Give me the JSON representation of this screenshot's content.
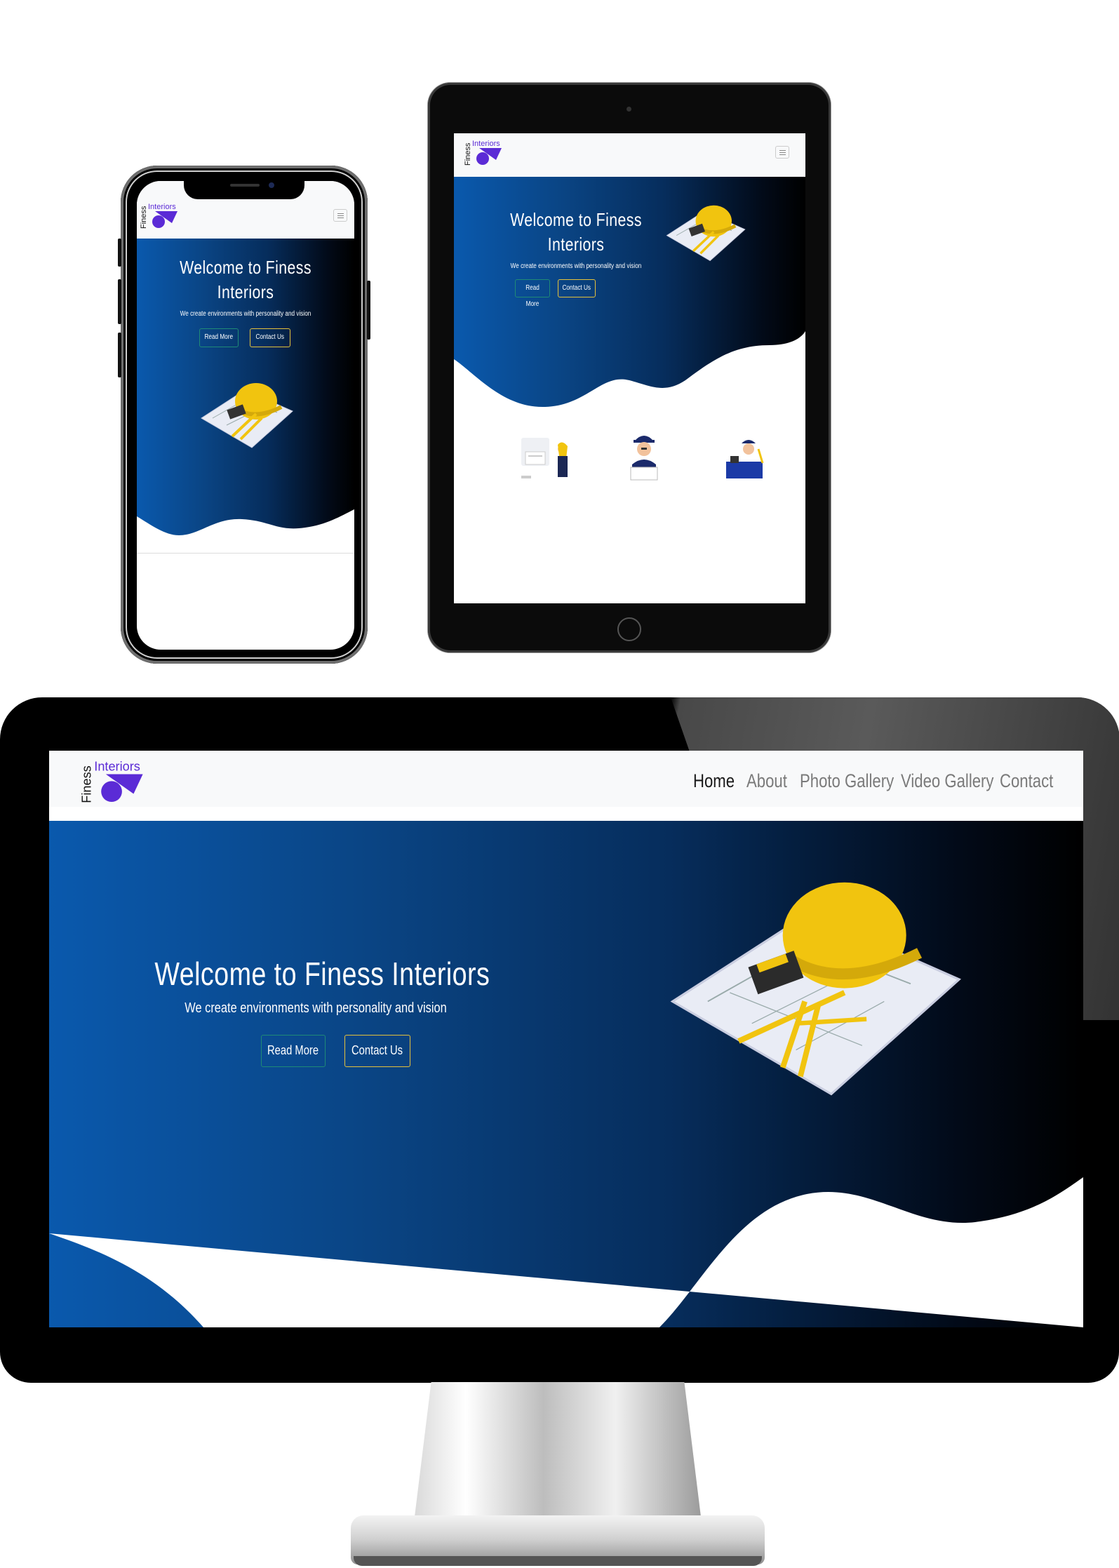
{
  "site": {
    "logo": {
      "word1": "Finess",
      "word2": "Interiors"
    },
    "hero": {
      "title": "Welcome to Finess Interiors",
      "title_line1": "Welcome to Finess",
      "title_line2": "Interiors",
      "subtitle": "We create environments with personality and vision",
      "read_more": "Read More",
      "contact_us": "Contact Us"
    },
    "nav": [
      "Home",
      "About",
      "Photo Gallery",
      "Video Gallery",
      "Contact"
    ],
    "active_nav": "Home"
  },
  "colors": {
    "gradient_start": "#0a59ad",
    "gradient_end": "#000000",
    "logo_purple": "#5b2bd6",
    "button_teal_border": "#1f8a76",
    "button_yellow_border": "#e5c23c",
    "navbar_bg": "#f8f9fa"
  },
  "icons": [
    "hamburger-menu-icon",
    "hard-hat-blueprint-image",
    "designer-illustration-icon",
    "engineer-illustration-icon",
    "architect-illustration-icon"
  ]
}
